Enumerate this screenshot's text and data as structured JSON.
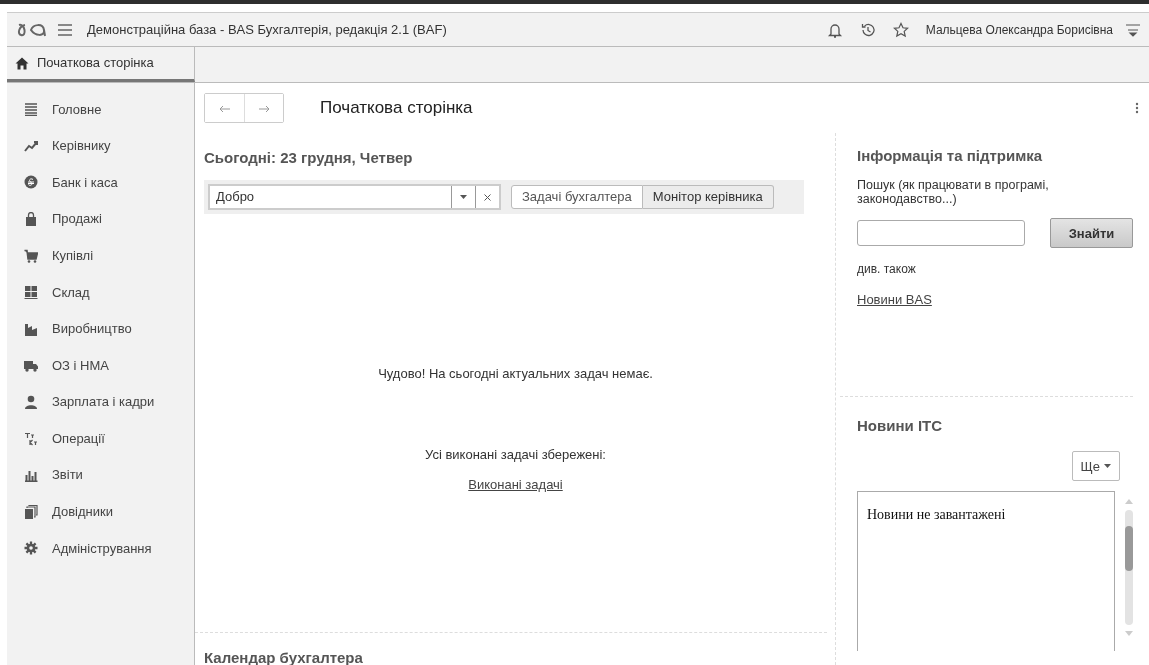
{
  "header": {
    "title": "Демонстраційна база - BAS Бухгалтерія, редакція 2.1  (BAF)",
    "user": "Мальцева Олександра Борисівна"
  },
  "open_tabs": [
    {
      "label": "Початкова сторінка",
      "selected": true
    }
  ],
  "sidebar": {
    "items": [
      {
        "label": "Головне",
        "kind": "lines"
      },
      {
        "label": "Керівнику",
        "kind": "trend"
      },
      {
        "label": "Банк і каса",
        "kind": "coin"
      },
      {
        "label": "Продажі",
        "kind": "bag"
      },
      {
        "label": "Купівлі",
        "kind": "cart"
      },
      {
        "label": "Склад",
        "kind": "grid"
      },
      {
        "label": "Виробництво",
        "kind": "factory"
      },
      {
        "label": "ОЗ і НМА",
        "kind": "truck"
      },
      {
        "label": "Зарплата і кадри",
        "kind": "person"
      },
      {
        "label": "Операції",
        "kind": "dtkt"
      },
      {
        "label": "Звіти",
        "kind": "bars"
      },
      {
        "label": "Довідники",
        "kind": "books"
      },
      {
        "label": "Адміністрування",
        "kind": "gear"
      }
    ]
  },
  "page": {
    "title": "Початкова сторінка",
    "today": "Сьогодні: 23 грудня, Четвер",
    "filter": {
      "value": "Добро",
      "switch": [
        {
          "label": "Задачі бухгалтера",
          "selected": false
        },
        {
          "label": "Монітор керівника",
          "selected": true
        }
      ]
    },
    "message": "Чудово! На сьогодні актуальних задач немає.",
    "saved_note": "Усі виконані задачі збережені:",
    "saved_link": "Виконані задачі",
    "calendar_heading": "Календар бухгалтера"
  },
  "support": {
    "heading": "Інформація та підтримка",
    "search_label": "Пошук (як працювати в програмі, законодавство...)",
    "search_button": "Знайти",
    "see_also": "див. також",
    "link": "Новини BAS"
  },
  "news": {
    "heading": "Новини ІТС",
    "more_button": "Ще",
    "content": "Новини не завантажені"
  }
}
